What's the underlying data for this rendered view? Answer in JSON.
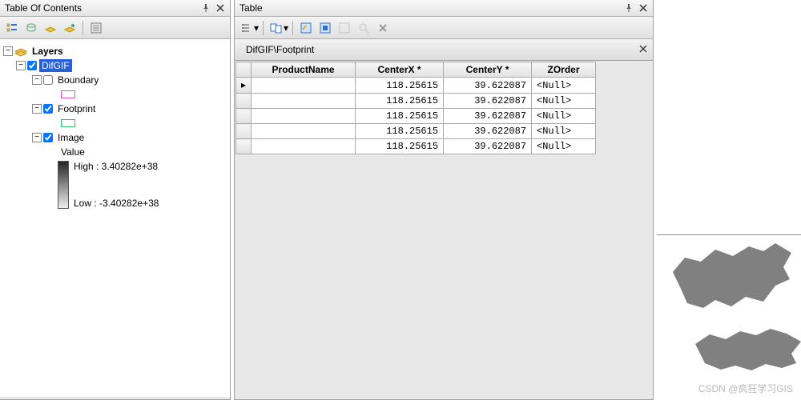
{
  "toc": {
    "title": "Table Of Contents",
    "root": "Layers",
    "group": "DifGIF",
    "boundary": "Boundary",
    "footprint": "Footprint",
    "image": "Image",
    "value": "Value",
    "high": "High : 3.40282e+38",
    "low": "Low : -3.40282e+38"
  },
  "table": {
    "title": "Table",
    "tab": "DifGIF\\Footprint",
    "columns": [
      "ProductName",
      "CenterX",
      "CenterY",
      "ZOrder"
    ],
    "rows": [
      {
        "ProductName": "",
        "CenterX": "118.25615",
        "CenterY": "39.622087",
        "ZOrder": "<Null>"
      },
      {
        "ProductName": "",
        "CenterX": "118.25615",
        "CenterY": "39.622087",
        "ZOrder": "<Null>"
      },
      {
        "ProductName": "",
        "CenterX": "118.25615",
        "CenterY": "39.622087",
        "ZOrder": "<Null>"
      },
      {
        "ProductName": "",
        "CenterX": "118.25615",
        "CenterY": "39.622087",
        "ZOrder": "<Null>"
      },
      {
        "ProductName": "",
        "CenterX": "118.25615",
        "CenterY": "39.622087",
        "ZOrder": "<Null>"
      }
    ]
  },
  "watermark": "CSDN @疯狂学习GIS"
}
